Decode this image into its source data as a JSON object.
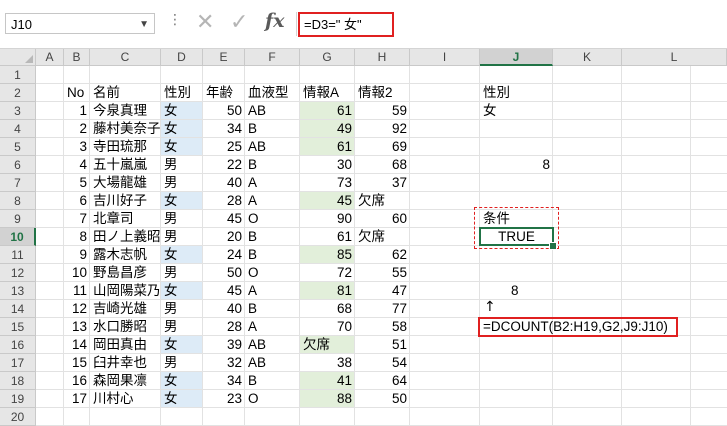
{
  "formula_bar": {
    "name_box": "J10",
    "formula": "=D3=\" 女\"",
    "cancel_icon": "✕",
    "enter_icon": "✓",
    "fx_label": "fx"
  },
  "columns": [
    "A",
    "B",
    "C",
    "D",
    "E",
    "F",
    "G",
    "H",
    "I",
    "J",
    "K",
    "L"
  ],
  "rows": [
    "1",
    "2",
    "3",
    "4",
    "5",
    "6",
    "7",
    "8",
    "9",
    "10",
    "11",
    "12",
    "13",
    "14",
    "15",
    "16",
    "17",
    "18",
    "19",
    "20"
  ],
  "selected_cell": {
    "col": "J",
    "row": "10"
  },
  "headers": {
    "B": "No",
    "C": "名前",
    "D": "性別",
    "E": "年齢",
    "F": "血液型",
    "G": "情報A",
    "H": "情報2"
  },
  "table": [
    {
      "no": "1",
      "name": "今泉真理",
      "sex": "女",
      "age": "50",
      "blood": "AB",
      "a": "61",
      "b": "59"
    },
    {
      "no": "2",
      "name": "藤村美奈子",
      "sex": "女",
      "age": "34",
      "blood": "B",
      "a": "49",
      "b": "92"
    },
    {
      "no": "3",
      "name": "寺田琉那",
      "sex": "女",
      "age": "25",
      "blood": "AB",
      "a": "61",
      "b": "69"
    },
    {
      "no": "4",
      "name": "五十嵐嵐",
      "sex": "男",
      "age": "22",
      "blood": "B",
      "a": "30",
      "b": "68"
    },
    {
      "no": "5",
      "name": "大場龍雄",
      "sex": "男",
      "age": "40",
      "blood": "A",
      "a": "73",
      "b": "37"
    },
    {
      "no": "6",
      "name": "吉川好子",
      "sex": "女",
      "age": "28",
      "blood": "A",
      "a": "45",
      "b": "欠席"
    },
    {
      "no": "7",
      "name": "北章司",
      "sex": "男",
      "age": "45",
      "blood": "O",
      "a": "90",
      "b": "60"
    },
    {
      "no": "8",
      "name": "田ノ上義昭",
      "sex": "男",
      "age": "20",
      "blood": "B",
      "a": "61",
      "b": "欠席"
    },
    {
      "no": "9",
      "name": "露木志帆",
      "sex": "女",
      "age": "24",
      "blood": "B",
      "a": "85",
      "b": "62"
    },
    {
      "no": "10",
      "name": "野島昌彦",
      "sex": "男",
      "age": "50",
      "blood": "O",
      "a": "72",
      "b": "55"
    },
    {
      "no": "11",
      "name": "山岡陽菜乃",
      "sex": "女",
      "age": "45",
      "blood": "A",
      "a": "81",
      "b": "47"
    },
    {
      "no": "12",
      "name": "吉崎光雄",
      "sex": "男",
      "age": "40",
      "blood": "B",
      "a": "68",
      "b": "77"
    },
    {
      "no": "13",
      "name": "水口勝昭",
      "sex": "男",
      "age": "28",
      "blood": "A",
      "a": "70",
      "b": "58"
    },
    {
      "no": "14",
      "name": "岡田真由",
      "sex": "女",
      "age": "39",
      "blood": "AB",
      "a": "欠席",
      "b": "51"
    },
    {
      "no": "15",
      "name": "臼井幸也",
      "sex": "男",
      "age": "32",
      "blood": "AB",
      "a": "38",
      "b": "54"
    },
    {
      "no": "16",
      "name": "森岡果凛",
      "sex": "女",
      "age": "34",
      "blood": "B",
      "a": "41",
      "b": "64"
    },
    {
      "no": "17",
      "name": "川村心",
      "sex": "女",
      "age": "23",
      "blood": "O",
      "a": "88",
      "b": "50"
    }
  ],
  "side": {
    "j2": "性別",
    "j3": "女",
    "j6": "8",
    "j9": "条件",
    "j10": "TRUE",
    "j13": "8",
    "j14_arrow": "↑",
    "j15": "=DCOUNT(B2:H19,G2,J9:J10)"
  },
  "colors": {
    "accent": "#217346",
    "highlight_red": "#e02020",
    "female_fill": "#ddebf7",
    "infoA_fill": "#e2efda"
  }
}
